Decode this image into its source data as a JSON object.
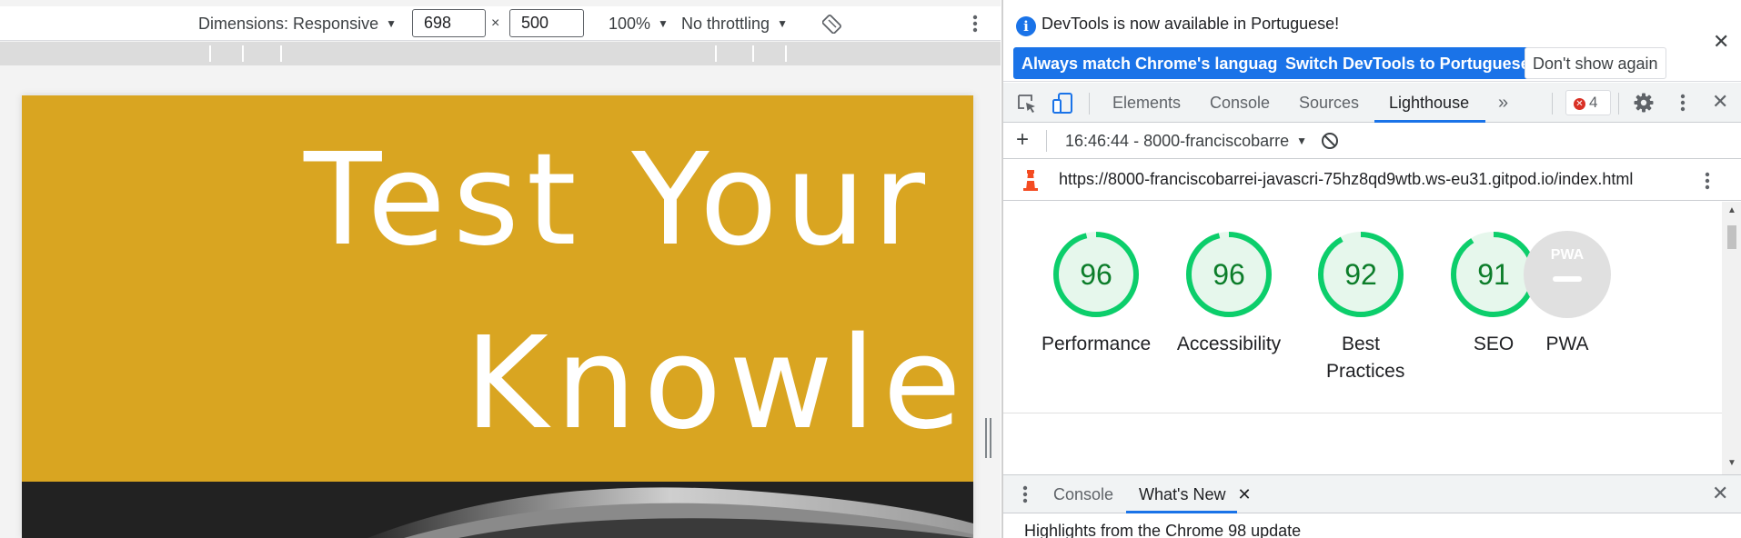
{
  "device_toolbar": {
    "dimensions_label": "Dimensions: Responsive",
    "width_value": "698",
    "times_sign": "×",
    "height_value": "500",
    "zoom_label": "100%",
    "throttling_label": "No throttling"
  },
  "page": {
    "hero_line_1": "Test Your M",
    "hero_line_2": "Knowledg",
    "hero_color": "#d9a521"
  },
  "infobar": {
    "message": "DevTools is now available in Portuguese!",
    "btn_match_language": "Always match Chrome's language",
    "btn_switch_portuguese": "Switch DevTools to Portuguese",
    "btn_dont_show": "Don't show again"
  },
  "tabs": {
    "elements": "Elements",
    "console": "Console",
    "sources": "Sources",
    "lighthouse": "Lighthouse",
    "error_count": "4"
  },
  "lighthouse": {
    "report_selector": "16:46:44 - 8000-franciscobarre",
    "url": "https://8000-franciscobarrei-javascri-75hz8qd9wtb.ws-eu31.gitpod.io/index.html",
    "scores": [
      {
        "label": "Performance",
        "value": "96",
        "fraction": 0.96
      },
      {
        "label": "Accessibility",
        "value": "96",
        "fraction": 0.96
      },
      {
        "label": "Best Practices",
        "value": "92",
        "fraction": 0.92
      },
      {
        "label": "SEO",
        "value": "91",
        "fraction": 0.91
      }
    ],
    "pwa_label": "PWA",
    "pwa_badge": "PWA",
    "pass_color": "#0cce6b"
  },
  "drawer": {
    "tab_console": "Console",
    "tab_whats_new": "What's New",
    "highlights": "Highlights from the Chrome 98 update"
  },
  "icons": {
    "device_toolbar": [
      "caret-down-icon",
      "rotate-icon",
      "more-vert-icon"
    ],
    "devtools": [
      "info-icon",
      "close-icon",
      "inspect-element-icon",
      "device-toggle-icon",
      "more-tabs-icon",
      "error-icon",
      "settings-gear-icon",
      "more-vert-icon",
      "add-icon",
      "block-icon",
      "lighthouse-logo-icon",
      "pwa-icon",
      "scroll-up-icon",
      "scroll-down-icon"
    ]
  }
}
